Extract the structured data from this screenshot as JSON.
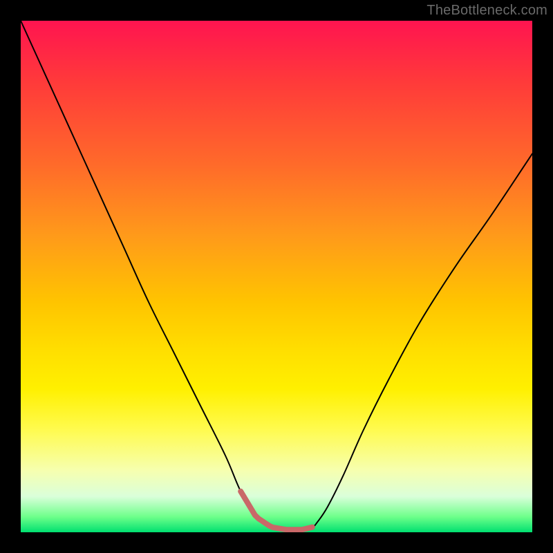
{
  "watermark": "TheBottleneck.com",
  "chart_data": {
    "type": "line",
    "title": "",
    "xlabel": "",
    "ylabel": "",
    "xlim": [
      0,
      100
    ],
    "ylim": [
      0,
      100
    ],
    "grid": false,
    "series": [
      {
        "name": "curve",
        "x": [
          0,
          5,
          10,
          15,
          20,
          25,
          30,
          35,
          40,
          43,
          46,
          49,
          52,
          55,
          57,
          58,
          60,
          63,
          67,
          72,
          78,
          85,
          92,
          100
        ],
        "values": [
          100,
          89,
          78,
          67,
          56,
          45,
          35,
          25,
          15,
          8,
          3,
          1,
          0.5,
          0.5,
          1,
          2,
          5,
          11,
          20,
          30,
          41,
          52,
          62,
          74
        ]
      }
    ],
    "curve_color": "#000000",
    "curve_stroke_width": 2,
    "highlight_band": {
      "x_start": 43,
      "x_end": 57,
      "color": "#c96868",
      "stroke_width": 8
    }
  }
}
